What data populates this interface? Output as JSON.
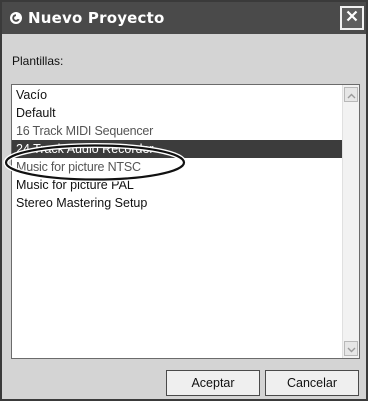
{
  "window": {
    "title": "Nuevo Proyecto",
    "close_icon": "close-icon"
  },
  "templates_label": "Plantillas:",
  "templates": {
    "items": [
      "Vacío",
      "Default",
      "16 Track MIDI Sequencer",
      "24 Track Audio Recorder",
      "Music for picture NTSC",
      "Music for picture PAL",
      "Stereo Mastering Setup"
    ],
    "selected": "24 Track Audio Recorder"
  },
  "buttons": {
    "accept": "Aceptar",
    "cancel": "Cancelar"
  },
  "colors": {
    "titlebar": "#4a4a4a",
    "selection": "#3c3c3c",
    "window_bg": "#d4d4d4"
  }
}
